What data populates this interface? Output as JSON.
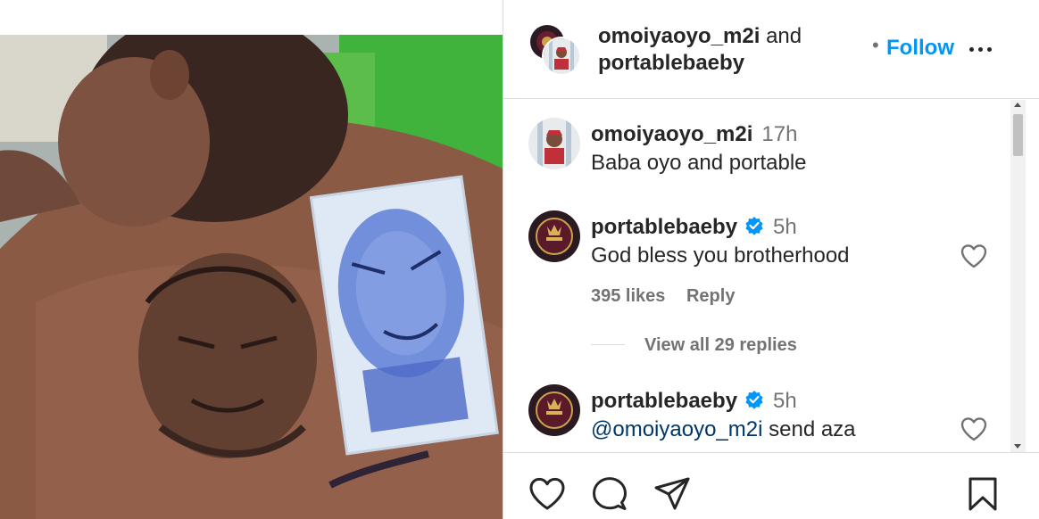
{
  "post": {
    "image_description_icon": "photo-icon"
  },
  "header": {
    "user1": "omoiyaoyo_m2i",
    "connector": "and",
    "user2": "portablebaeby",
    "dot": "•",
    "follow_label": "Follow",
    "more_icon": "more-icon"
  },
  "comments": [
    {
      "username": "omoiyaoyo_m2i",
      "time": "17h",
      "text": "Baba oyo and portable"
    },
    {
      "username": "portablebaeby",
      "time": "5h",
      "text": "God bless you brotherhood",
      "likes": "395 likes",
      "reply": "Reply",
      "verified": true
    },
    {
      "username": "portablebaeby",
      "time": "5h",
      "mention": "@omoiyaoyo_m2i",
      "text": " send aza",
      "verified": true
    }
  ],
  "view_replies": "View all 29 replies",
  "actions": {
    "like_icon": "heart-icon",
    "comment_icon": "comment-icon",
    "share_icon": "send-icon",
    "save_icon": "bookmark-icon"
  },
  "colors": {
    "accent": "#0095f6",
    "text": "#262626",
    "muted": "#737373",
    "verified": "#0095f6",
    "border": "#dbdbdb"
  }
}
